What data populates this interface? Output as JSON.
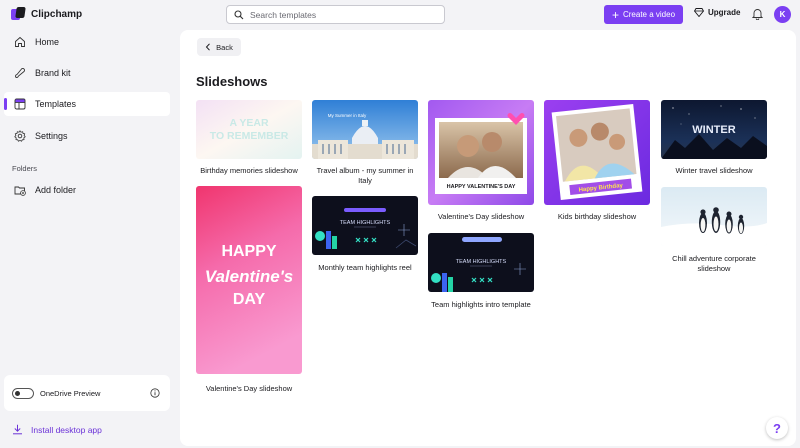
{
  "app": {
    "name": "Clipchamp"
  },
  "search": {
    "placeholder": "Search templates"
  },
  "header": {
    "create_label": "Create a video",
    "upgrade_label": "Upgrade",
    "avatar_initial": "K",
    "accent_color": "#7b3ff2"
  },
  "sidebar": {
    "items": [
      {
        "label": "Home",
        "icon": "home-icon"
      },
      {
        "label": "Brand kit",
        "icon": "brand-kit-icon"
      },
      {
        "label": "Templates",
        "icon": "templates-icon",
        "active": true
      },
      {
        "label": "Settings",
        "icon": "gear-icon"
      }
    ],
    "folders_label": "Folders",
    "add_folder_label": "Add folder",
    "onedrive_label": "OneDrive Preview",
    "install_label": "Install desktop app"
  },
  "main": {
    "back_label": "Back",
    "title": "Slideshows",
    "templates": [
      {
        "label": "Birthday memories slideshow",
        "art_text": [
          "A YEAR",
          "TO REMEMBER"
        ]
      },
      {
        "label": "Travel album - my summer in Italy",
        "art_text": [
          "My Summer in Italy"
        ]
      },
      {
        "label": "Valentine's Day slideshow",
        "art_text": [
          "HAPPY VALENTINE'S DAY"
        ]
      },
      {
        "label": "Kids birthday slideshow",
        "art_text": [
          "Happy Birthday"
        ]
      },
      {
        "label": "Winter travel slideshow",
        "art_text": [
          "WINTER"
        ]
      },
      {
        "label": "Valentine's Day slideshow",
        "art_text": [
          "HAPPY",
          "Valentine's",
          "DAY"
        ]
      },
      {
        "label": "Monthly team highlights reel",
        "art_text": [
          "TEAM HIGHLIGHTS"
        ]
      },
      {
        "label": "Team highlights intro template",
        "art_text": [
          "TEAM HIGHLIGHTS"
        ]
      },
      {
        "label": "Chill adventure corporate slideshow",
        "art_text": []
      }
    ]
  },
  "help": {
    "label": "?"
  }
}
